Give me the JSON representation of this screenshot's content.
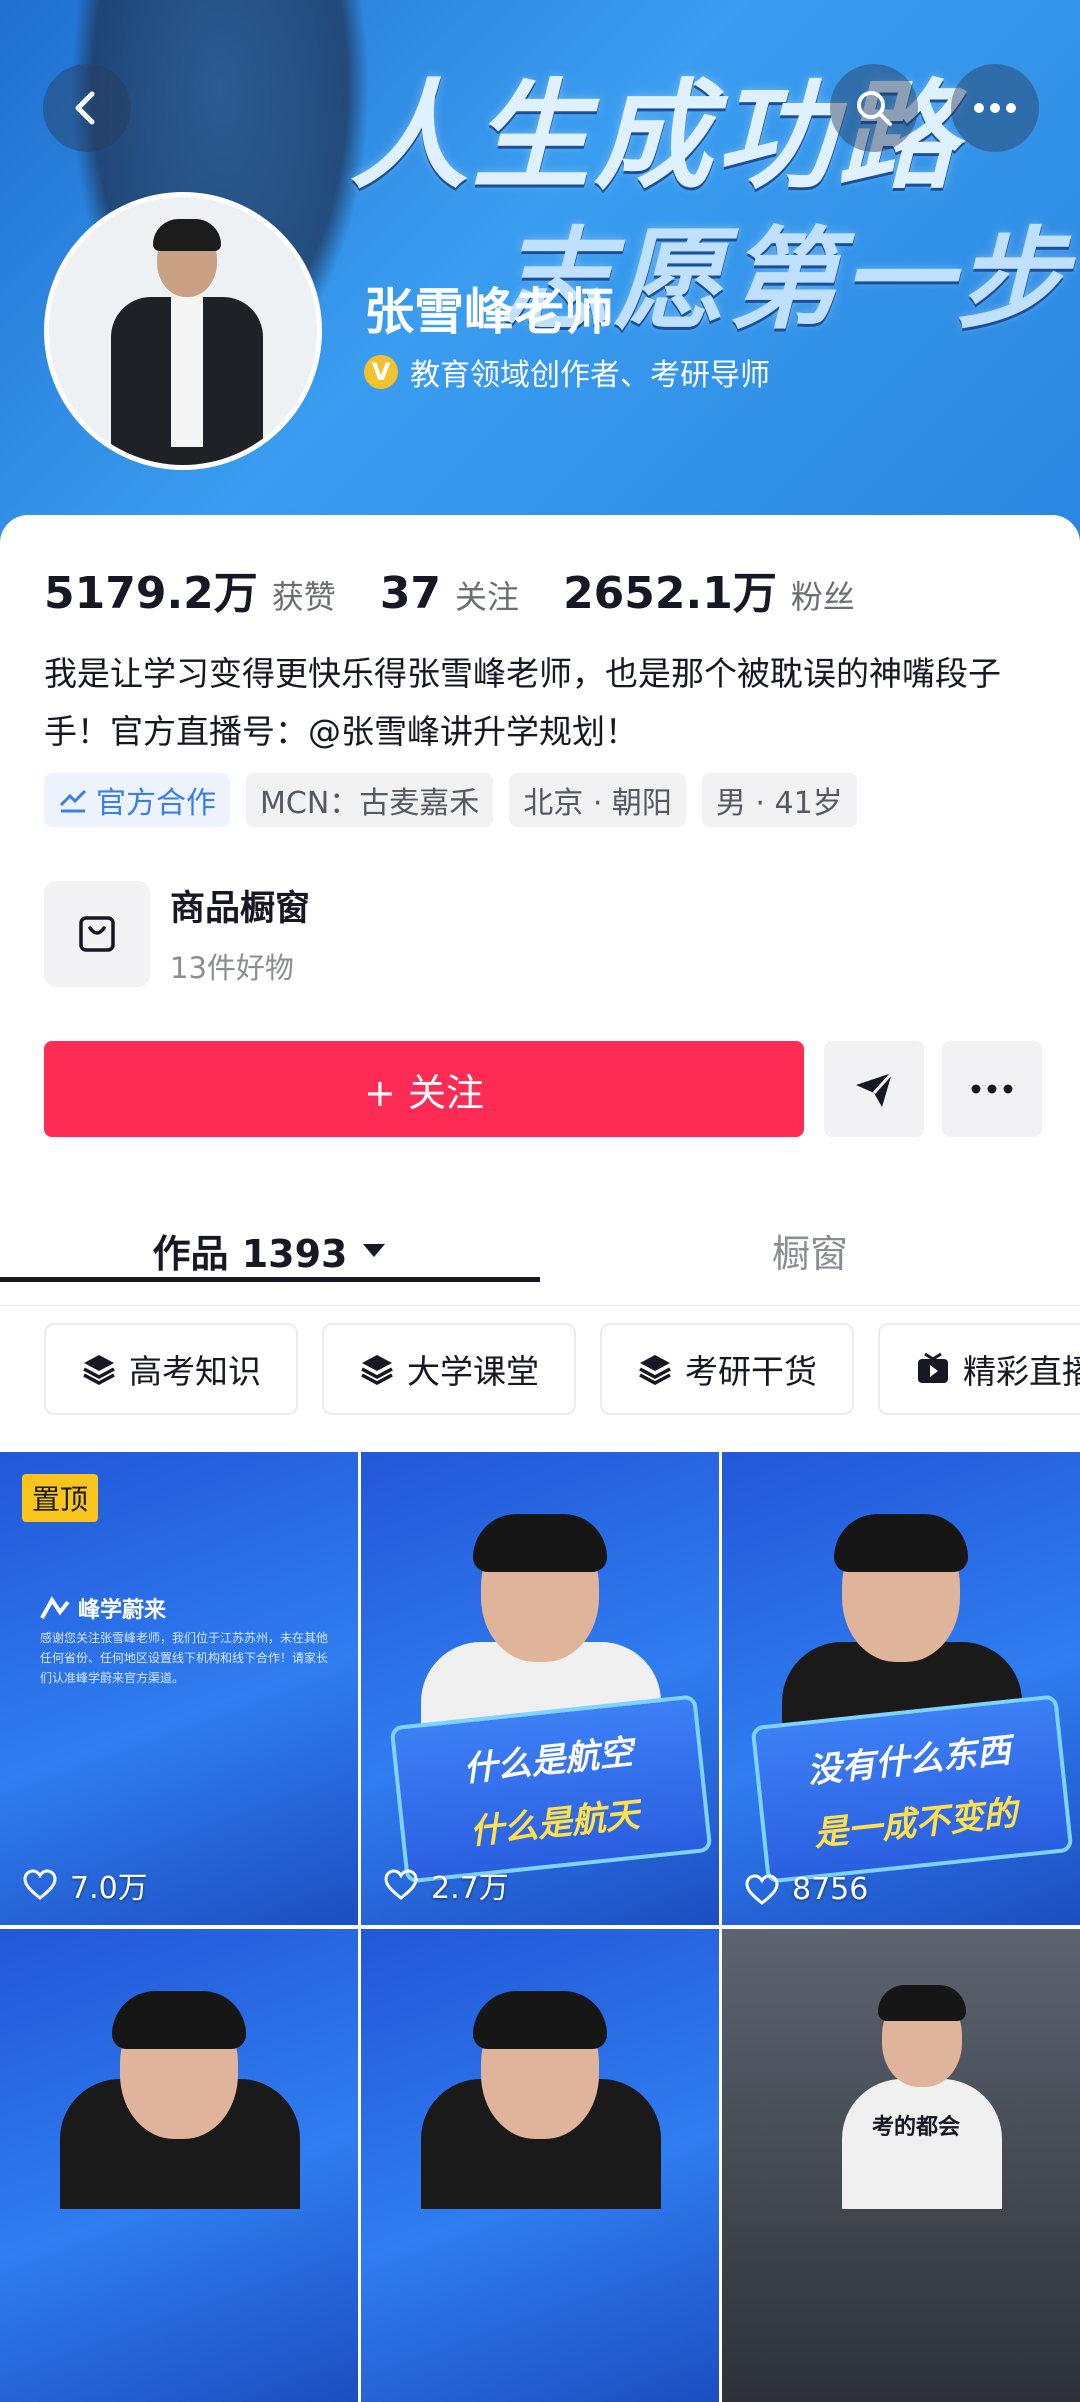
{
  "banner": {
    "line1": "人生成功路",
    "line2": "志愿第一步"
  },
  "profile": {
    "name": "张雪峰老师",
    "verify_badge": "V",
    "verify_text": "教育领域创作者、考研导师"
  },
  "stats": [
    {
      "value": "5179.2万",
      "label": "获赞"
    },
    {
      "value": "37",
      "label": "关注"
    },
    {
      "value": "2652.1万",
      "label": "粉丝"
    }
  ],
  "bio": "我是让学习变得更快乐得张雪峰老师，也是那个被耽误的神嘴段子手！官方直播号：@张雪峰讲升学规划！",
  "tags": [
    "官方合作",
    "MCN：古麦嘉禾",
    "北京 · 朝阳",
    "男 · 41岁"
  ],
  "shop": {
    "title": "商品橱窗",
    "subtitle": "13件好物"
  },
  "follow_label": "+ 关注",
  "tabs": {
    "works": "作品 1393",
    "window": "橱窗"
  },
  "categories": [
    "高考知识",
    "大学课堂",
    "考研干货",
    "精彩直播"
  ],
  "videos": [
    {
      "pinned": "置顶",
      "logo": "峰学蔚来",
      "notice": "感谢您关注张雪峰老师，我们位于江苏苏州，未在其他任何省份、任何地区设置线下机构和线下合作！请家长们认准峰学蔚来官方渠道。",
      "likes": "7.0万"
    },
    {
      "caption1": "什么是航空",
      "caption2": "什么是航天",
      "likes": "2.7万"
    },
    {
      "caption1": "没有什么东西",
      "caption2": "是一成不变的",
      "likes": "8756"
    },
    {
      "caption1": "",
      "caption2": "",
      "likes": ""
    },
    {
      "caption1": "",
      "caption2": "",
      "likes": ""
    },
    {
      "caption1": "考的都会",
      "caption2": "",
      "likes": ""
    }
  ],
  "colors": {
    "accent": "#fe2c55",
    "official": "#3b7de9",
    "pin": "#f7c51c"
  }
}
